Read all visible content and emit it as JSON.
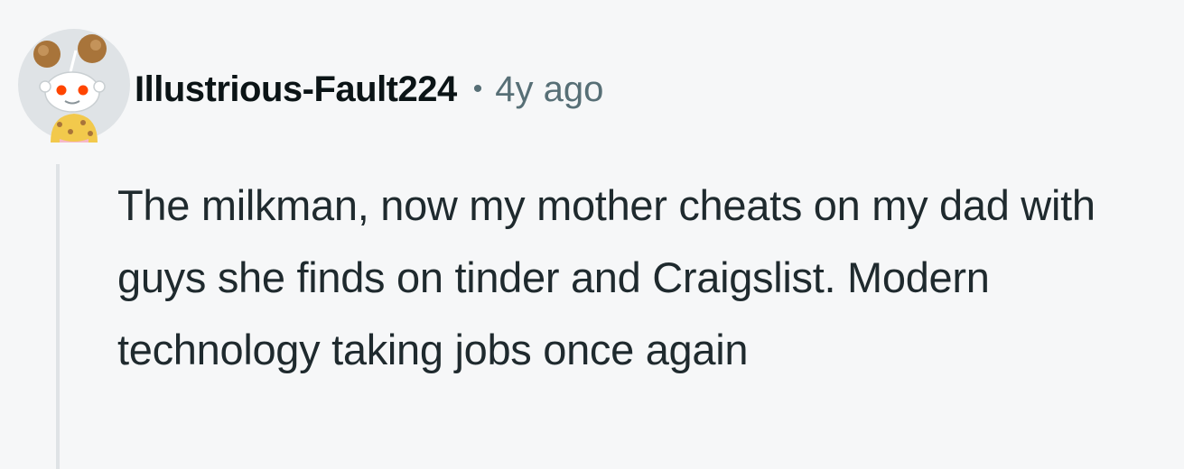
{
  "comment": {
    "username": "Illustrious-Fault224",
    "separator": "•",
    "timestamp": "4y ago",
    "body": "The milkman, now my mother cheats on my dad with guys she finds on tinder and Craigslist. Modern technology taking jobs once again"
  },
  "avatar": {
    "icon": "snoo-avatar-icon",
    "colors": {
      "background": "#dfe3e6",
      "face": "#ffffff",
      "eyes": "#ff4500",
      "hair": "#a8743a",
      "shirt": "#f2c94c"
    }
  },
  "colors": {
    "background": "#f6f7f8",
    "username": "#0b1416",
    "meta": "#576f76",
    "body_text": "#1f2a2e",
    "thread_line": "#dfe3e6"
  }
}
